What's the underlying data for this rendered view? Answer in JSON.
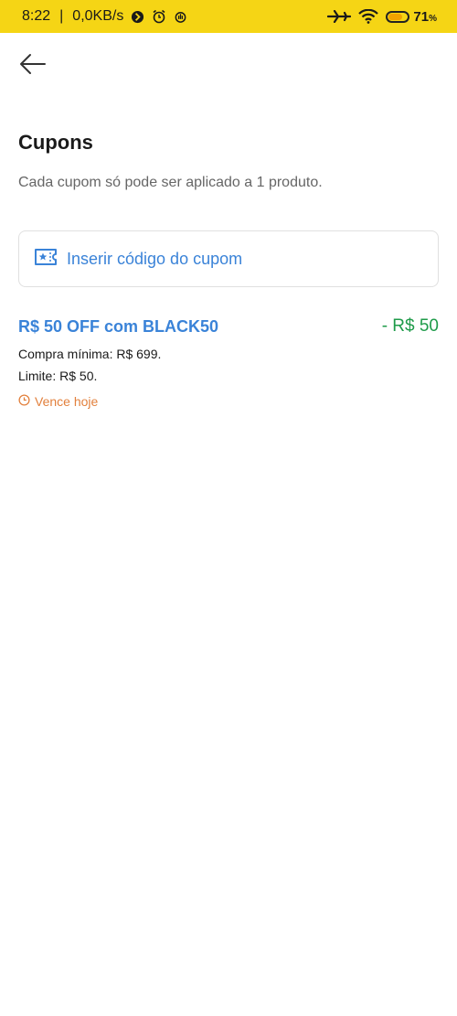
{
  "status_bar": {
    "time": "8:22",
    "network_speed": "0,0KB/s",
    "battery_percent": "71",
    "battery_symbol": "%",
    "battery_level": 0.71,
    "background_color": "#f5d515"
  },
  "header": {
    "back_icon": "arrow-left-icon",
    "title": "Cupons",
    "subtitle": "Cada cupom só pode ser aplicado a 1 produto."
  },
  "coupon_input": {
    "icon": "ticket-star-icon",
    "label": "Inserir código do cupom"
  },
  "coupons": [
    {
      "title": "R$ 50 OFF com BLACK50",
      "discount": "- R$ 50",
      "min_purchase": "Compra mínima: R$ 699.",
      "limit": "Limite: R$ 50.",
      "expiry": "Vence hoje",
      "expiry_icon": "clock-icon"
    }
  ],
  "colors": {
    "accent_blue": "#3a83d8",
    "discount_green": "#1f9b4a",
    "expiry_orange": "#e2803d"
  }
}
